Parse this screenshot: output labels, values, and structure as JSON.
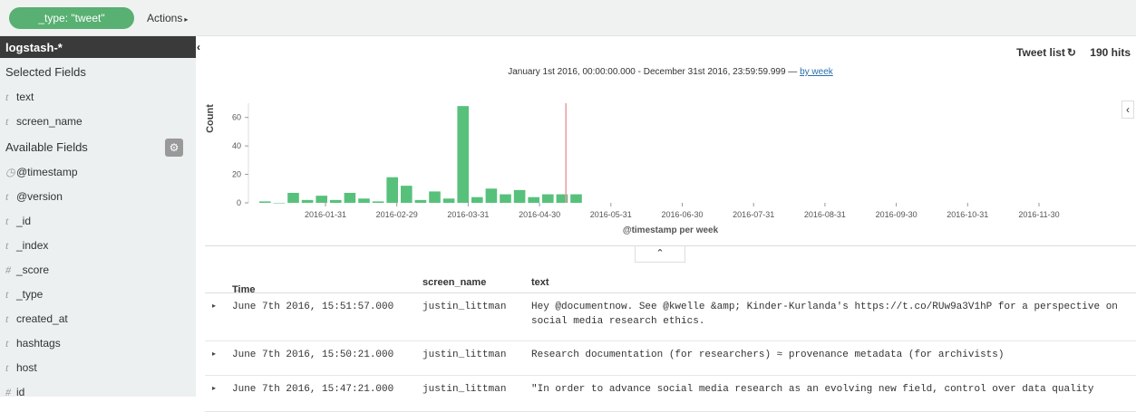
{
  "filter_bar": {
    "filter_pill": "_type: \"tweet\"",
    "actions_label": "Actions"
  },
  "sidebar": {
    "index_pattern": "logstash-*",
    "selected_heading": "Selected Fields",
    "selected_fields": [
      {
        "type": "t",
        "name": "text"
      },
      {
        "type": "t",
        "name": "screen_name"
      }
    ],
    "available_heading": "Available Fields",
    "available_fields": [
      {
        "type": "◷",
        "name": "@timestamp"
      },
      {
        "type": "t",
        "name": "@version"
      },
      {
        "type": "t",
        "name": "_id"
      },
      {
        "type": "t",
        "name": "_index"
      },
      {
        "type": "#",
        "name": "_score"
      },
      {
        "type": "t",
        "name": "_type"
      },
      {
        "type": "t",
        "name": "created_at"
      },
      {
        "type": "t",
        "name": "hashtags"
      },
      {
        "type": "t",
        "name": "host"
      },
      {
        "type": "#",
        "name": "id"
      }
    ]
  },
  "header": {
    "saved_search": "Tweet list",
    "hits": "190 hits"
  },
  "time_range": {
    "text": "January 1st 2016, 00:00:00.000 - December 31st 2016, 23:59:59.999 — ",
    "interval_link": "by week"
  },
  "chart_data": {
    "type": "bar",
    "ylabel": "Count",
    "xlabel": "@timestamp per week",
    "ylim": [
      0,
      70
    ],
    "yticks": [
      0,
      20,
      40,
      60
    ],
    "xtick_labels": [
      "2016-01-31",
      "2016-02-29",
      "2016-03-31",
      "2016-04-30",
      "2016-05-31",
      "2016-06-30",
      "2016-07-31",
      "2016-08-31",
      "2016-09-30",
      "2016-10-31",
      "2016-11-30"
    ],
    "values": [
      1,
      0,
      7,
      2,
      5,
      2,
      7,
      3,
      1,
      18,
      12,
      2,
      8,
      3,
      68,
      4,
      10,
      6,
      9,
      4,
      6,
      6,
      6
    ],
    "bar_color": "#57c17b",
    "marker_color": "#e89ba3"
  },
  "table": {
    "headers": {
      "time": "Time",
      "screen_name": "screen_name",
      "text": "text"
    },
    "rows": [
      {
        "time": "June 7th 2016, 15:51:57.000",
        "screen_name": "justin_littman",
        "text": "Hey @documentnow. See @kwelle &amp; Kinder-Kurlanda's https://t.co/RUw9a3V1hP for a perspective on social media research ethics."
      },
      {
        "time": "June 7th 2016, 15:50:21.000",
        "screen_name": "justin_littman",
        "text": "Research documentation (for researchers) ≈ provenance metadata (for archivists)"
      },
      {
        "time": "June 7th 2016, 15:47:21.000",
        "screen_name": "justin_littman",
        "text": "\"In order to advance social media research as an evolving new field, control over data quality"
      }
    ]
  },
  "icons": {
    "actions_caret": "▸",
    "refresh": "↻",
    "collapse_left": "‹",
    "toggle_up": "⌃",
    "gear": "⚙",
    "row_expand": "▸",
    "sort_caret": "⌄"
  }
}
